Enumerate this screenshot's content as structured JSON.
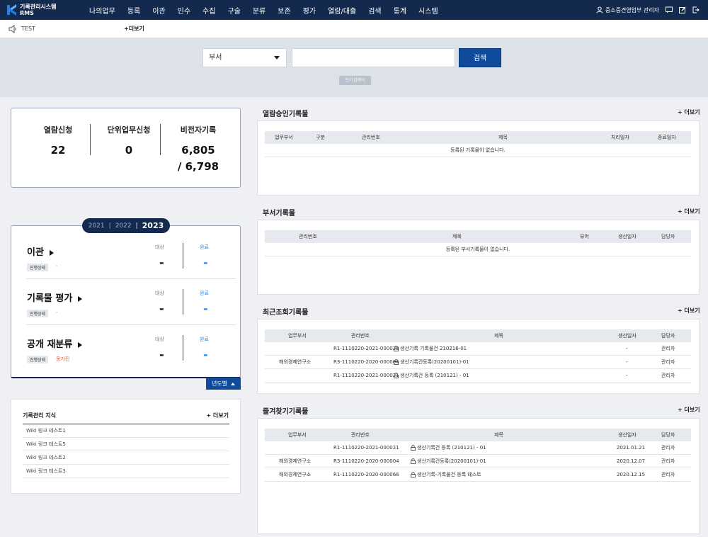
{
  "header": {
    "logo_line1": "기록관리시스템",
    "logo_line2": "RMS",
    "menu": [
      "나의업무",
      "등록",
      "이관",
      "인수",
      "수집",
      "구술",
      "분류",
      "보존",
      "평가",
      "열람/대출",
      "검색",
      "통계",
      "시스템"
    ],
    "user": "중소중견영업부 관리자"
  },
  "notice": {
    "text": "TEST",
    "more": "+더보기"
  },
  "search": {
    "dept_option": "부서",
    "button": "검색",
    "popular": "인기검색어"
  },
  "stats": {
    "items": [
      {
        "label": "열람신청",
        "value": "22"
      },
      {
        "label": "단위업무신청",
        "value": "0"
      },
      {
        "label": "비전자기록",
        "value": "6,805",
        "value2": "/ 6,798"
      }
    ]
  },
  "years": {
    "y1": "2021",
    "y2": "2022",
    "y3": "2023",
    "sep": "|"
  },
  "year_rows": [
    {
      "title": "이관",
      "badge": "진행상태",
      "status": "-",
      "target_label": "대상",
      "done_label": "완료",
      "target": "-",
      "done": "-"
    },
    {
      "title": "기록물 평가",
      "badge": "진행상태",
      "status": "-",
      "target_label": "대상",
      "done_label": "완료",
      "target": "-",
      "done": "-"
    },
    {
      "title": "공개 재분류",
      "badge": "진행상태",
      "status": "몽가진",
      "target_label": "대상",
      "done_label": "완료",
      "target": "-",
      "done": "-"
    }
  ],
  "year_button": "년도별",
  "knowledge": {
    "title": "기록관리 지식",
    "more": "+ 더보기",
    "items": [
      "Wiki 링크 테스트1",
      "Wiki 링크 테스트5",
      "Wiki 링크 테스트2",
      "Wiki 링크 테스트3"
    ]
  },
  "panels": {
    "approval": {
      "title": "열람승인기록물",
      "more": "+ 더보기",
      "headers": [
        "업무부서",
        "구분",
        "관리번호",
        "제목",
        "처리일자",
        "종료일자"
      ],
      "empty": "등록된 기록물이 없습니다."
    },
    "dept": {
      "title": "부서기록물",
      "more": "+ 더보기",
      "headers": [
        "관리번호",
        "제목",
        "뷰어",
        "생산일자",
        "담당자"
      ],
      "empty": "등록된 부서기록물이 없습니다."
    },
    "recent": {
      "title": "최근조회기록물",
      "more": "+ 더보기",
      "headers": [
        "업무부서",
        "관리번호",
        "제목",
        "생산일자",
        "담당자"
      ],
      "rows": [
        {
          "dept": "",
          "id": "R1-1110220-2021-000029",
          "title": "생산기록 기록물건 210216-01",
          "date": "-",
          "owner": "관리자"
        },
        {
          "dept": "해외경제연구소",
          "id": "R3-1110220-2020-000004",
          "title": "생산기록건등록(20200101)-01",
          "date": "-",
          "owner": "관리자"
        },
        {
          "dept": "",
          "id": "R1-1110220-2021-000021",
          "title": "생산기록건 등록 (210121) - 01",
          "date": "-",
          "owner": "관리자"
        }
      ]
    },
    "favorite": {
      "title": "즐겨찾기기록물",
      "more": "+ 더보기",
      "headers": [
        "업무부서",
        "관리번호",
        "제목",
        "생산일자",
        "담당자"
      ],
      "rows": [
        {
          "dept": "",
          "id": "R1-1110220-2021-000021",
          "title": "생산기록건 등록 (210121) - 01",
          "date": "2021.01.21",
          "owner": "관리자"
        },
        {
          "dept": "해외경제연구소",
          "id": "R3-1110220-2020-000004",
          "title": "생산기록건등록(20200101)-01",
          "date": "2020.12.07",
          "owner": "관리자"
        },
        {
          "dept": "해외경제연구소",
          "id": "R1-1110220-2020-000066",
          "title": "생산기록-기록물건 등록 테스트",
          "date": "2020.12.15",
          "owner": "관리자"
        }
      ]
    }
  }
}
